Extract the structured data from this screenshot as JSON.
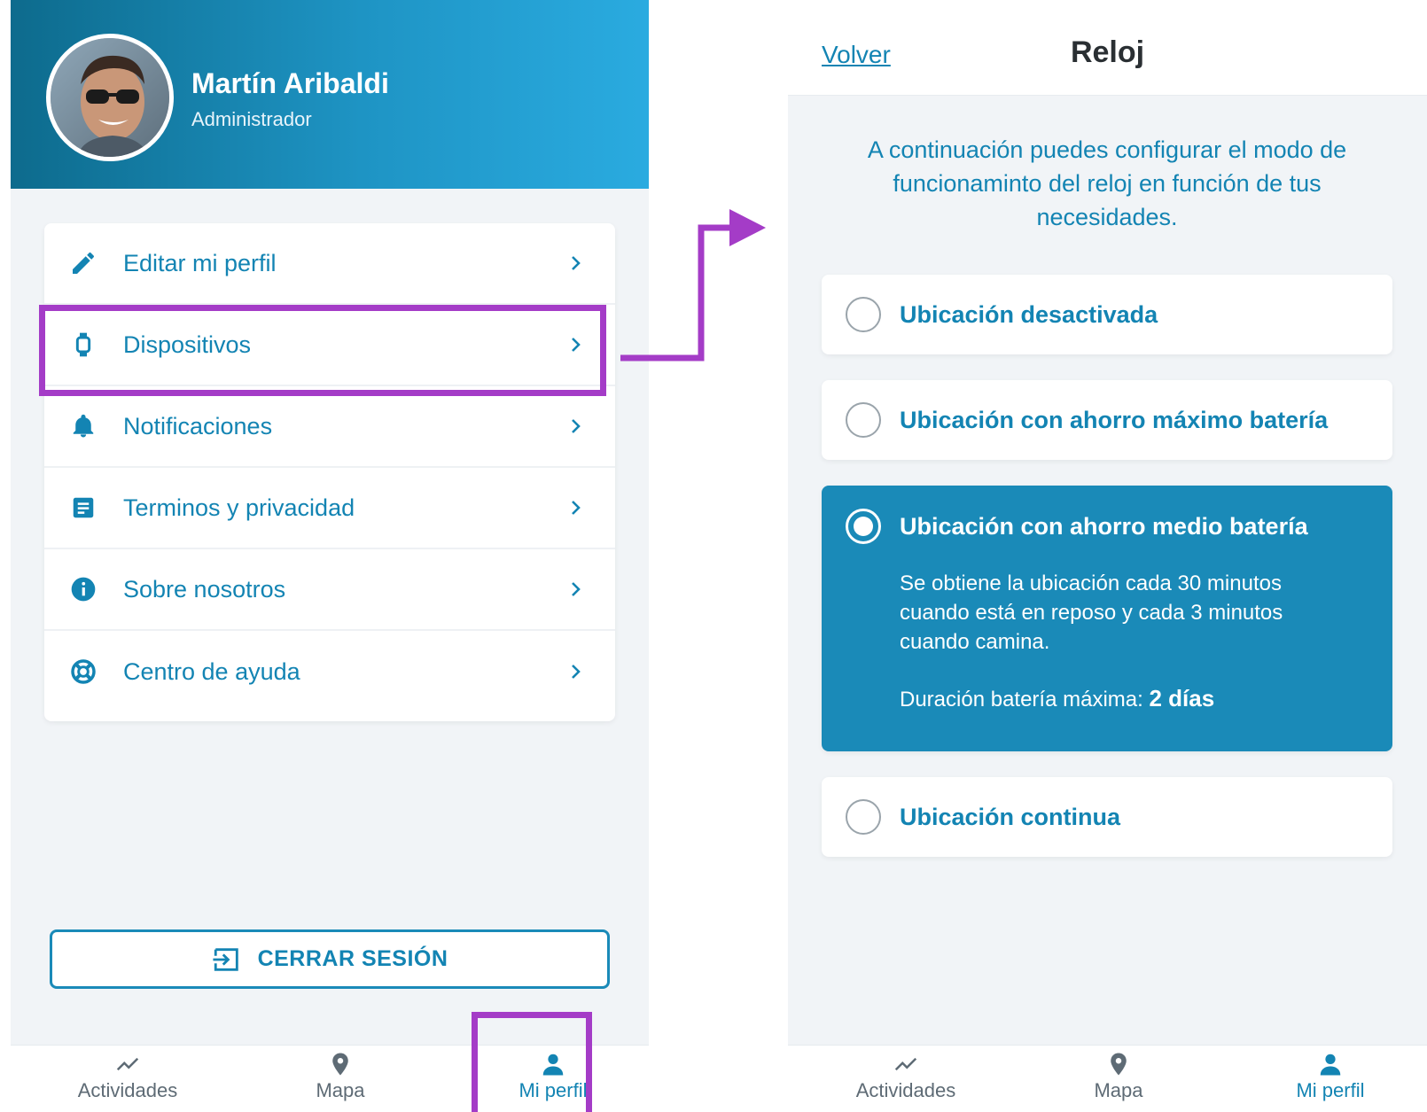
{
  "profile": {
    "name": "Martín Aribaldi",
    "role": "Administrador"
  },
  "menu": {
    "items": [
      {
        "label": "Editar mi perfil",
        "icon": "pencil-icon"
      },
      {
        "label": "Dispositivos",
        "icon": "watch-icon"
      },
      {
        "label": "Notificaciones",
        "icon": "bell-icon"
      },
      {
        "label": "Terminos y privacidad",
        "icon": "document-icon"
      },
      {
        "label": "Sobre nosotros",
        "icon": "info-icon"
      },
      {
        "label": "Centro de ayuda",
        "icon": "lifebuoy-icon"
      }
    ]
  },
  "logout": {
    "label": "CERRAR SESIÓN",
    "icon": "logout-icon"
  },
  "nav": {
    "items": [
      {
        "label": "Actividades",
        "icon": "activity-icon"
      },
      {
        "label": "Mapa",
        "icon": "map-pin-icon"
      },
      {
        "label": "Mi perfil",
        "icon": "user-icon"
      }
    ],
    "active": "Mi perfil"
  },
  "clock": {
    "back_label": "Volver",
    "title": "Reloj",
    "intro": "A continuación puedes configurar el modo de funcionaminto del reloj en función de tus necesidades.",
    "options": [
      {
        "title": "Ubicación desactivada",
        "selected": false
      },
      {
        "title": "Ubicación con ahorro máximo batería",
        "selected": false
      },
      {
        "title": "Ubicación con ahorro medio batería",
        "selected": true,
        "description": "Se obtiene la ubicación cada 30 minutos cuando está en reposo y cada 3 minutos cuando camina.",
        "battery_label": "Duración batería máxima:",
        "battery_value": "2 días"
      },
      {
        "title": "Ubicación continua",
        "selected": false
      }
    ]
  },
  "colors": {
    "accent": "#1384b3",
    "selected_bg": "#1a8ab8",
    "highlight": "#a43cc7",
    "header_gradient_start": "#0d6b8d",
    "header_gradient_end": "#2aabe0"
  }
}
